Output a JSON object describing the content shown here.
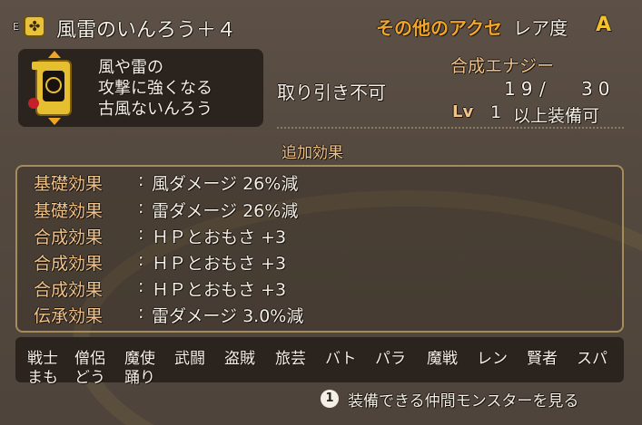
{
  "header": {
    "equip_mark": "E",
    "icon": "clover-icon",
    "item_name": "風雷のいんろう＋４",
    "category": "その他のアクセ",
    "rarity_label": "レア度",
    "rarity_value": "A"
  },
  "description": {
    "lines": [
      "風や雷の",
      "攻撃に強くなる",
      "古風ないんろう"
    ]
  },
  "info": {
    "trade_status": "取り引き不可",
    "synergy_label": "合成エナジー",
    "synergy_current": "19",
    "synergy_sep": "/",
    "synergy_max": "30",
    "level_label": "Lv",
    "level_value": "1",
    "level_suffix": "以上装備可"
  },
  "effects": {
    "title": "追加効果",
    "rows": [
      {
        "category": "基礎効果",
        "value": "風ダメージ 26%減"
      },
      {
        "category": "基礎効果",
        "value": "雷ダメージ 26%減"
      },
      {
        "category": "合成効果",
        "value": "ＨＰとおもさ +3"
      },
      {
        "category": "合成効果",
        "value": "ＨＰとおもさ +3"
      },
      {
        "category": "合成効果",
        "value": "ＨＰとおもさ +3"
      },
      {
        "category": "伝承効果",
        "value": "雷ダメージ 3.0%減"
      }
    ]
  },
  "jobs": [
    "戦士",
    "僧侶",
    "魔使",
    "武闘",
    "盗賊",
    "旅芸",
    "バト",
    "パラ",
    "魔戦",
    "レン",
    "賢者",
    "スパ",
    "まも",
    "どう",
    "踊り"
  ],
  "monster_button": {
    "key": "1",
    "label": "装備できる仲間モンスターを見る"
  },
  "colors": {
    "accent": "#f1a526",
    "rarity": "#f1c12e",
    "label": "#f1c38a",
    "panel": "#54493f"
  }
}
